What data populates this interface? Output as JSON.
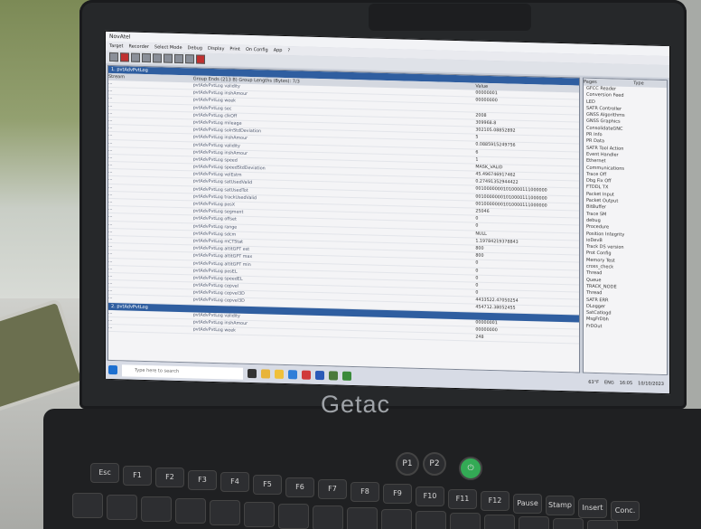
{
  "device": {
    "brand": "Getac"
  },
  "app": {
    "title": "NovAtel",
    "menu": [
      "Target",
      "Recorder",
      "Select Mode",
      "Debug",
      "Display",
      "Print",
      "On Config",
      "App",
      "?"
    ],
    "log_pane_title": "1. pvtAdvPvtLog",
    "columns": [
      "Stream",
      "Format",
      "Record",
      "Value"
    ],
    "group_info": "Group Ends (213 B)   Group Lengths (Bytes): 7/3",
    "rows": [
      {
        "stream": "...",
        "format": "...",
        "record": "pvtAdvPvtLog validity",
        "value": "00000001"
      },
      {
        "stream": "...",
        "format": "...",
        "record": "pvtAdvPvtLog inshAmour",
        "value": "00000000"
      },
      {
        "stream": "...",
        "format": "...",
        "record": "pvtAdvPvtLog week",
        "value": ""
      },
      {
        "stream": "...",
        "format": "...",
        "record": "pvtAdvPvtLog sec",
        "value": "2008"
      },
      {
        "stream": "...",
        "format": "...",
        "record": "pvtAdvPvtLog clkOff",
        "value": "309968.8"
      },
      {
        "stream": "...",
        "format": "...",
        "record": "pvtAdvPvtLog mileage",
        "value": "302105.08852892"
      },
      {
        "stream": "...",
        "format": "...",
        "record": "pvtAdvPvtLog solnStdDeviation",
        "value": "5"
      },
      {
        "stream": "...",
        "format": "...",
        "record": "pvtAdvPvtLog inshAmour",
        "value": "0.0885915249756"
      },
      {
        "stream": "...",
        "format": "...",
        "record": "pvtAdvPvtLog validity",
        "value": "6"
      },
      {
        "stream": "...",
        "format": "...",
        "record": "pvtAdvPvtLog inshAmour",
        "value": "1"
      },
      {
        "stream": "...",
        "format": "...",
        "record": "pvtAdvPvtLog speed",
        "value": "MASK_VALID"
      },
      {
        "stream": "...",
        "format": "...",
        "record": "pvtAdvPvtLog speedStdDeviation",
        "value": "45.496746917462"
      },
      {
        "stream": "...",
        "format": "...",
        "record": "pvtAdvPvtLog velEstm",
        "value": "0.27491352944422"
      },
      {
        "stream": "...",
        "format": "...",
        "record": "pvtAdvPvtLog satUsedValid",
        "value": "00100000001010000111000000"
      },
      {
        "stream": "...",
        "format": "...",
        "record": "pvtAdvPvtLog satUsedTot",
        "value": "00100000001010000111000000"
      },
      {
        "stream": "...",
        "format": "...",
        "record": "pvtAdvPvtLog trackUsedValid",
        "value": "00100000001010000111000000"
      },
      {
        "stream": "...",
        "format": "...",
        "record": "pvtAdvPvtLog posX",
        "value": "25046"
      },
      {
        "stream": "...",
        "format": "...",
        "record": "pvtAdvPvtLog segment",
        "value": "0"
      },
      {
        "stream": "...",
        "format": "...",
        "record": "pvtAdvPvtLog offset",
        "value": "0"
      },
      {
        "stream": "...",
        "format": "...",
        "record": "pvtAdvPvtLog range",
        "value": "NULL"
      },
      {
        "stream": "...",
        "format": "...",
        "record": "pvtAdvPvtLog sdcm",
        "value": "1.19784219378843"
      },
      {
        "stream": "...",
        "format": "...",
        "record": "pvtAdvPvtLog mCTStat",
        "value": "800"
      },
      {
        "stream": "...",
        "format": "...",
        "record": "pvtAdvPvtLog altitGPT est",
        "value": "800"
      },
      {
        "stream": "...",
        "format": "...",
        "record": "pvtAdvPvtLog altitGPT max",
        "value": "0"
      },
      {
        "stream": "...",
        "format": "...",
        "record": "pvtAdvPvtLog altitGPT min",
        "value": "0"
      },
      {
        "stream": "...",
        "format": "...",
        "record": "pvtAdvPvtLog posEL",
        "value": "0"
      },
      {
        "stream": "...",
        "format": "...",
        "record": "pvtAdvPvtLog speedEL",
        "value": "0"
      },
      {
        "stream": "...",
        "format": "...",
        "record": "pvtAdvPvtLog cepvel",
        "value": "0"
      },
      {
        "stream": "...",
        "format": "...",
        "record": "pvtAdvPvtLog cepvel3D",
        "value": "4433522.47050254"
      },
      {
        "stream": "...",
        "format": "...",
        "record": "pvtAdvPvtLog cepvel3D",
        "value": "454712.38052455"
      }
    ],
    "sub_pane_title": "2. pvtAdvPvtLog",
    "sub_rows": [
      {
        "stream": "...",
        "format": "...",
        "record": "pvtAdvPvtLog validity",
        "value": "00000001"
      },
      {
        "stream": "...",
        "format": "...",
        "record": "pvtAdvPvtLog inshAmour",
        "value": "00000000"
      },
      {
        "stream": "...",
        "format": "...",
        "record": "pvtAdvPvtLog week",
        "value": "248"
      }
    ],
    "side_header": [
      "Pages",
      "Type"
    ],
    "side_items": [
      "GFCC Reader",
      "Conversion Feed",
      "LED",
      "SATR Controller",
      "GNSS Algorithms",
      "GNSS Graphics",
      "ConsolidateGNC",
      "PR Info",
      "PR Data",
      "SATR Tool Action",
      "Event Handler",
      "Ethernet",
      "Communications",
      "Trace Off",
      "Dbg Fix Off",
      "FTDDL TX",
      "Packet Input",
      "Packet Output",
      "BitBuffer",
      "Trace SM",
      "debug",
      "Procedure",
      "Position Integrity",
      "ioDevB",
      "Track DS version",
      "Prot Config",
      "Memory Test",
      "cross_check",
      "Thread",
      "Queue",
      "TRACK_NODE",
      "Thread",
      "SATR ERR",
      "DLogger",
      "SatCatlogd",
      "MsgFrDbh",
      "FrDOut"
    ],
    "taskbar": {
      "search_placeholder": "Type here to search",
      "weather": "63°F",
      "lang": "ENG",
      "time": "16:05",
      "date": "10/10/2023"
    }
  },
  "keys": [
    "Esc",
    "F1",
    "F2",
    "F3",
    "F4",
    "F5",
    "F6",
    "F7",
    "F8",
    "F9",
    "F10",
    "F11",
    "F12",
    "Pause",
    "Stamp",
    "Insert",
    "Conc."
  ],
  "buttons": {
    "p1": "P1",
    "p2": "P2"
  }
}
